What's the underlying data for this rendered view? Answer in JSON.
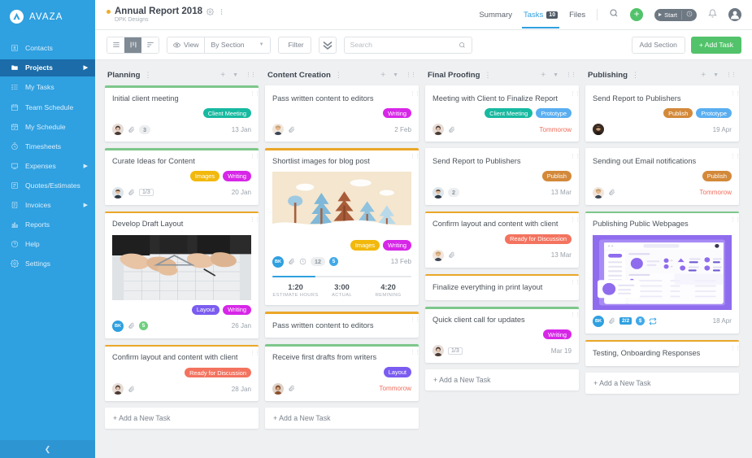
{
  "brand": {
    "name": "AVAZA",
    "logo_icon": "avaza-logo-icon"
  },
  "sidebar": {
    "collapse_icon": "chevron-left-icon",
    "items": [
      {
        "label": "Contacts",
        "icon": "contacts-icon",
        "active": false,
        "has_arrow": false
      },
      {
        "label": "Projects",
        "icon": "folder-icon",
        "active": true,
        "has_arrow": true
      },
      {
        "label": "My Tasks",
        "icon": "tasks-icon",
        "active": false,
        "has_arrow": false
      },
      {
        "label": "Team Schedule",
        "icon": "calendar-icon",
        "active": false,
        "has_arrow": false
      },
      {
        "label": "My Schedule",
        "icon": "calendar-check-icon",
        "active": false,
        "has_arrow": false
      },
      {
        "label": "Timesheets",
        "icon": "clock-icon",
        "active": false,
        "has_arrow": false
      },
      {
        "label": "Expenses",
        "icon": "expenses-icon",
        "active": false,
        "has_arrow": true
      },
      {
        "label": "Quotes/Estimates",
        "icon": "quote-icon",
        "active": false,
        "has_arrow": false
      },
      {
        "label": "Invoices",
        "icon": "invoice-icon",
        "active": false,
        "has_arrow": true
      },
      {
        "label": "Reports",
        "icon": "reports-icon",
        "active": false,
        "has_arrow": false
      },
      {
        "label": "Help",
        "icon": "help-icon",
        "active": false,
        "has_arrow": false
      },
      {
        "label": "Settings",
        "icon": "gear-icon",
        "active": false,
        "has_arrow": false
      }
    ]
  },
  "header": {
    "project_title": "Annual Report 2018",
    "project_subtitle": "DPK Designs",
    "status_dot_color": "#f0ad2e",
    "settings_icon": "gear-icon",
    "more_icon": "more-vertical-icon",
    "tabs": [
      {
        "label": "Summary",
        "active": false,
        "count": null
      },
      {
        "label": "Tasks",
        "active": true,
        "count": "10"
      },
      {
        "label": "Files",
        "active": false,
        "count": null
      }
    ],
    "search_icon": "search-icon",
    "add_icon": "plus-icon",
    "timer_label": "Start",
    "timer_icon": "play-icon",
    "timer_clock_icon": "clock-icon",
    "notifications_icon": "bell-icon",
    "account_icon": "user-avatar-icon"
  },
  "toolbar": {
    "view_modes": [
      {
        "icon": "list-view-icon",
        "active": false
      },
      {
        "icon": "board-view-icon",
        "active": true
      },
      {
        "icon": "gantt-view-icon",
        "active": false
      }
    ],
    "view_label": "View",
    "view_icon": "eye-icon",
    "group_by_value": "By Section",
    "group_by_caret": "chevron-down-icon",
    "filter_label": "Filter",
    "filter_icon": "funnel-icon",
    "expand_icon": "chevrons-down-icon",
    "search_placeholder": "Search",
    "search_value": "",
    "search_icon": "search-icon",
    "add_section_label": "Add Section",
    "add_task_label": "+ Add Task"
  },
  "board": {
    "add_task_label": "+ Add a New Task",
    "columns": [
      {
        "title": "Planning",
        "menu_icon": "more-vertical-icon",
        "add_icon": "plus-icon",
        "collapse_icon": "chevron-down-icon",
        "drag_icon": "drag-handle-icon",
        "cards": [
          {
            "title": "Initial client meeting",
            "bar_color": "#7dc78b",
            "tags": [
              {
                "label": "Client Meeting",
                "color": "#17b9a0"
              }
            ],
            "avatar": "photo-female-1",
            "has_clip": true,
            "pill_gray": "3",
            "date": "13 Jan",
            "due": false
          },
          {
            "title": "Curate Ideas for Content",
            "bar_color": "#7dc78b",
            "tags": [
              {
                "label": "Images",
                "color": "#f2b90c"
              },
              {
                "label": "Writing",
                "color": "#d726e8"
              }
            ],
            "avatar": "photo-male-1",
            "has_clip": true,
            "pill_box": "1/3",
            "date": "20 Jan",
            "due": false
          },
          {
            "title": "Develop Draft Layout",
            "bar_color": "#eaa728",
            "image": "blueprint-team-photo",
            "tags": [
              {
                "label": "Layout",
                "color": "#7b5cf0"
              },
              {
                "label": "Writing",
                "color": "#d726e8"
              }
            ],
            "avatar_initial": "BK",
            "has_clip": true,
            "badge_round": {
              "label": "5",
              "color": "#6fcf7f"
            },
            "date": "26 Jan",
            "due": false
          },
          {
            "title": "Confirm layout and content with client",
            "bar_color": "#eaa728",
            "tags": [
              {
                "label": "Ready for Discussion",
                "color": "#f3735f"
              }
            ],
            "avatar": "photo-female-1",
            "has_clip": true,
            "date": "28 Jan",
            "due": false
          }
        ]
      },
      {
        "title": "Content Creation",
        "menu_icon": "more-vertical-icon",
        "add_icon": "plus-icon",
        "collapse_icon": "chevron-down-icon",
        "drag_icon": "drag-handle-icon",
        "cards": [
          {
            "title": "Pass written content to editors",
            "bar_color": "#ffffff",
            "tags": [
              {
                "label": "Writing",
                "color": "#d726e8"
              }
            ],
            "avatar": "photo-female-2",
            "has_clip": true,
            "date": "2 Feb",
            "due": false
          },
          {
            "title": "Shortlist images for blog post",
            "bar_color": "#eaa728",
            "image": "forest-illustration",
            "tags": [
              {
                "label": "Images",
                "color": "#f2b90c"
              },
              {
                "label": "Writing",
                "color": "#d726e8"
              }
            ],
            "avatar_initial": "BK",
            "has_clip": true,
            "has_clock": true,
            "pill_gray": "12",
            "badge_round": {
              "label": "5",
              "color": "#41a9e8"
            },
            "date": "13 Feb",
            "due": false,
            "tracker": {
              "progress_pct": 31,
              "cells": [
                {
                  "value": "1:20",
                  "label": "ESTIMATE HOURS"
                },
                {
                  "value": "3:00",
                  "label": "ACTUAL"
                },
                {
                  "value": "4:20",
                  "label": "REMINING"
                }
              ]
            }
          },
          {
            "title": "Pass written content to editors",
            "bar_color": "#eaa728",
            "compact": true
          },
          {
            "title": "Receive first drafts from writers",
            "bar_color": "#7dc78b",
            "tags": [
              {
                "label": "Layout",
                "color": "#7b5cf0"
              }
            ],
            "avatar": "photo-female-3",
            "has_clip": true,
            "date": "Tommorow",
            "due": true
          }
        ]
      },
      {
        "title": "Final Proofing",
        "menu_icon": "more-vertical-icon",
        "add_icon": "plus-icon",
        "collapse_icon": "chevron-down-icon",
        "drag_icon": "drag-handle-icon",
        "cards": [
          {
            "title": "Meeting with Client to Finalize Report",
            "bar_color": "#ffffff",
            "tags": [
              {
                "label": "Client Meeting",
                "color": "#17b9a0"
              },
              {
                "label": "Prototype",
                "color": "#5aaef0"
              }
            ],
            "avatar": "photo-female-1",
            "has_clip": true,
            "date": "Tommorow",
            "due": true
          },
          {
            "title": "Send Report to Publishers",
            "bar_color": "#ffffff",
            "tags": [
              {
                "label": "Publish",
                "color": "#d3893a"
              }
            ],
            "avatar": "photo-male-1",
            "pill_gray": "2",
            "date": "13 Mar",
            "due": false
          },
          {
            "title": "Confirm layout and content with client",
            "bar_color": "#eaa728",
            "tags": [
              {
                "label": "Ready for Discussion",
                "color": "#f3735f"
              }
            ],
            "avatar": "photo-female-2",
            "has_clip": true,
            "date": "13 Mar",
            "due": false
          },
          {
            "title": "Finalize everything in print layout",
            "bar_color": "#eaa728",
            "compact": true
          },
          {
            "title": "Quick client call for updates",
            "bar_color": "#7dc78b",
            "tags": [
              {
                "label": "Writing",
                "color": "#d726e8"
              }
            ],
            "avatar": "photo-female-1",
            "pill_box": "1/3",
            "date": "Mar 19",
            "due": false
          }
        ]
      },
      {
        "title": "Publishing",
        "menu_icon": "more-vertical-icon",
        "add_icon": "plus-icon",
        "collapse_icon": "chevron-down-icon",
        "drag_icon": "drag-handle-icon",
        "cards": [
          {
            "title": "Send Report to Publishers",
            "bar_color": "#ffffff",
            "tags": [
              {
                "label": "Publish",
                "color": "#d3893a"
              },
              {
                "label": "Prototype",
                "color": "#5aaef0"
              }
            ],
            "avatar": "photo-male-2",
            "date": "19 Apr",
            "due": false
          },
          {
            "title": "Sending out Email notifications",
            "bar_color": "#ffffff",
            "tags": [
              {
                "label": "Publish",
                "color": "#d3893a"
              }
            ],
            "avatar": "photo-female-2",
            "has_clip": true,
            "date": "Tommorow",
            "due": true
          },
          {
            "title": "Publishing Public Webpages",
            "bar_color": "#7dc78b",
            "image": "dashboard-mockup",
            "avatar_initial": "BK",
            "has_clip": true,
            "badge_sq": "2/2",
            "badge_round": {
              "label": "$",
              "color": "#41a9e8"
            },
            "has_repeat": true,
            "date": "18 Apr",
            "due": false
          },
          {
            "title": "Testing, Onboarding Responses",
            "bar_color": "#eaa728",
            "compact": true
          }
        ]
      }
    ]
  }
}
